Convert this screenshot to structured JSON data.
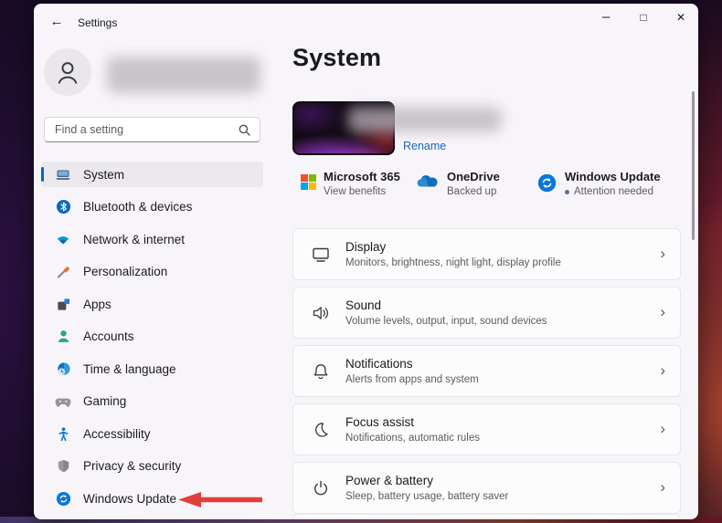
{
  "titlebar": {
    "title": "Settings",
    "back_glyph": "←",
    "minimize_glyph": "–",
    "maximize_glyph": "□",
    "close_glyph": "✕"
  },
  "sidebar": {
    "search_placeholder": "Find a setting",
    "items": [
      {
        "label": "System",
        "icon": "laptop-icon",
        "selected": true
      },
      {
        "label": "Bluetooth & devices",
        "icon": "bluetooth-icon",
        "selected": false
      },
      {
        "label": "Network & internet",
        "icon": "wifi-icon",
        "selected": false
      },
      {
        "label": "Personalization",
        "icon": "brush-icon",
        "selected": false
      },
      {
        "label": "Apps",
        "icon": "apps-grid-icon",
        "selected": false
      },
      {
        "label": "Accounts",
        "icon": "person-icon",
        "selected": false
      },
      {
        "label": "Time & language",
        "icon": "clock-globe-icon",
        "selected": false
      },
      {
        "label": "Gaming",
        "icon": "controller-icon",
        "selected": false
      },
      {
        "label": "Accessibility",
        "icon": "accessibility-icon",
        "selected": false
      },
      {
        "label": "Privacy & security",
        "icon": "shield-icon",
        "selected": false
      },
      {
        "label": "Windows Update",
        "icon": "sync-icon",
        "selected": false
      }
    ]
  },
  "main": {
    "page_title": "System",
    "rename_label": "Rename",
    "status_items": [
      {
        "title": "Microsoft 365",
        "subtitle": "View benefits"
      },
      {
        "title": "OneDrive",
        "subtitle": "Backed up"
      },
      {
        "title": "Windows Update",
        "subtitle": "Attention needed"
      }
    ],
    "cards": [
      {
        "title": "Display",
        "subtitle": "Monitors, brightness, night light, display profile"
      },
      {
        "title": "Sound",
        "subtitle": "Volume levels, output, input, sound devices"
      },
      {
        "title": "Notifications",
        "subtitle": "Alerts from apps and system"
      },
      {
        "title": "Focus assist",
        "subtitle": "Notifications, automatic rules"
      },
      {
        "title": "Power & battery",
        "subtitle": "Sleep, battery usage, battery saver"
      }
    ],
    "chevron_glyph": "›"
  },
  "colors": {
    "accent_blue": "#0067c0",
    "link_blue": "#1766c2",
    "update_blue": "#0078d4",
    "arrow_red": "#e1403a",
    "ms_red": "#f25022",
    "ms_green": "#7fba00",
    "ms_blue": "#00a4ef",
    "ms_yellow": "#ffb900"
  }
}
